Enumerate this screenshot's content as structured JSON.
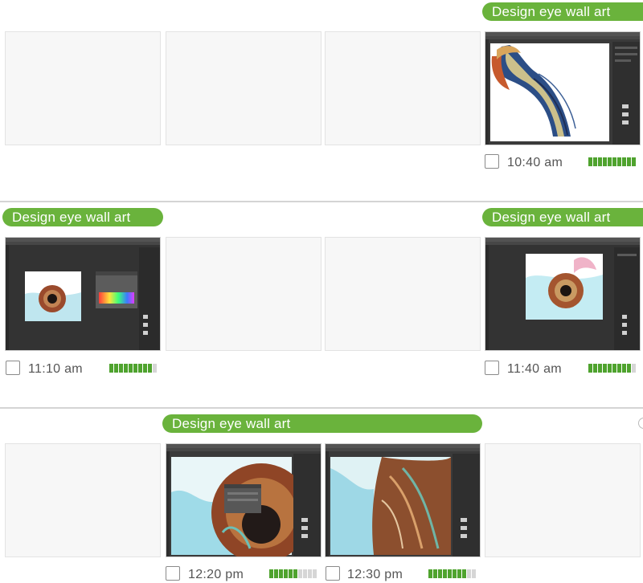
{
  "rows": [
    {
      "session_label": "Design eye wall art",
      "entries": [
        {
          "time": "10:40 am",
          "activity_level": 1.0
        }
      ]
    },
    {
      "session_label": "Design eye wall art",
      "entries": [
        {
          "time": "11:10 am",
          "activity_level": 0.9
        },
        {
          "time": "11:40 am",
          "activity_level": 0.9
        }
      ]
    },
    {
      "session_label": "Design eye wall art",
      "entries": [
        {
          "time": "12:20 pm",
          "activity_level": 0.6
        },
        {
          "time": "12:30 pm",
          "activity_level": 0.8
        }
      ]
    }
  ],
  "colors": {
    "accent": "#6ab33c",
    "meter_on": "#4fa32e",
    "meter_off": "#d6d6d6"
  }
}
